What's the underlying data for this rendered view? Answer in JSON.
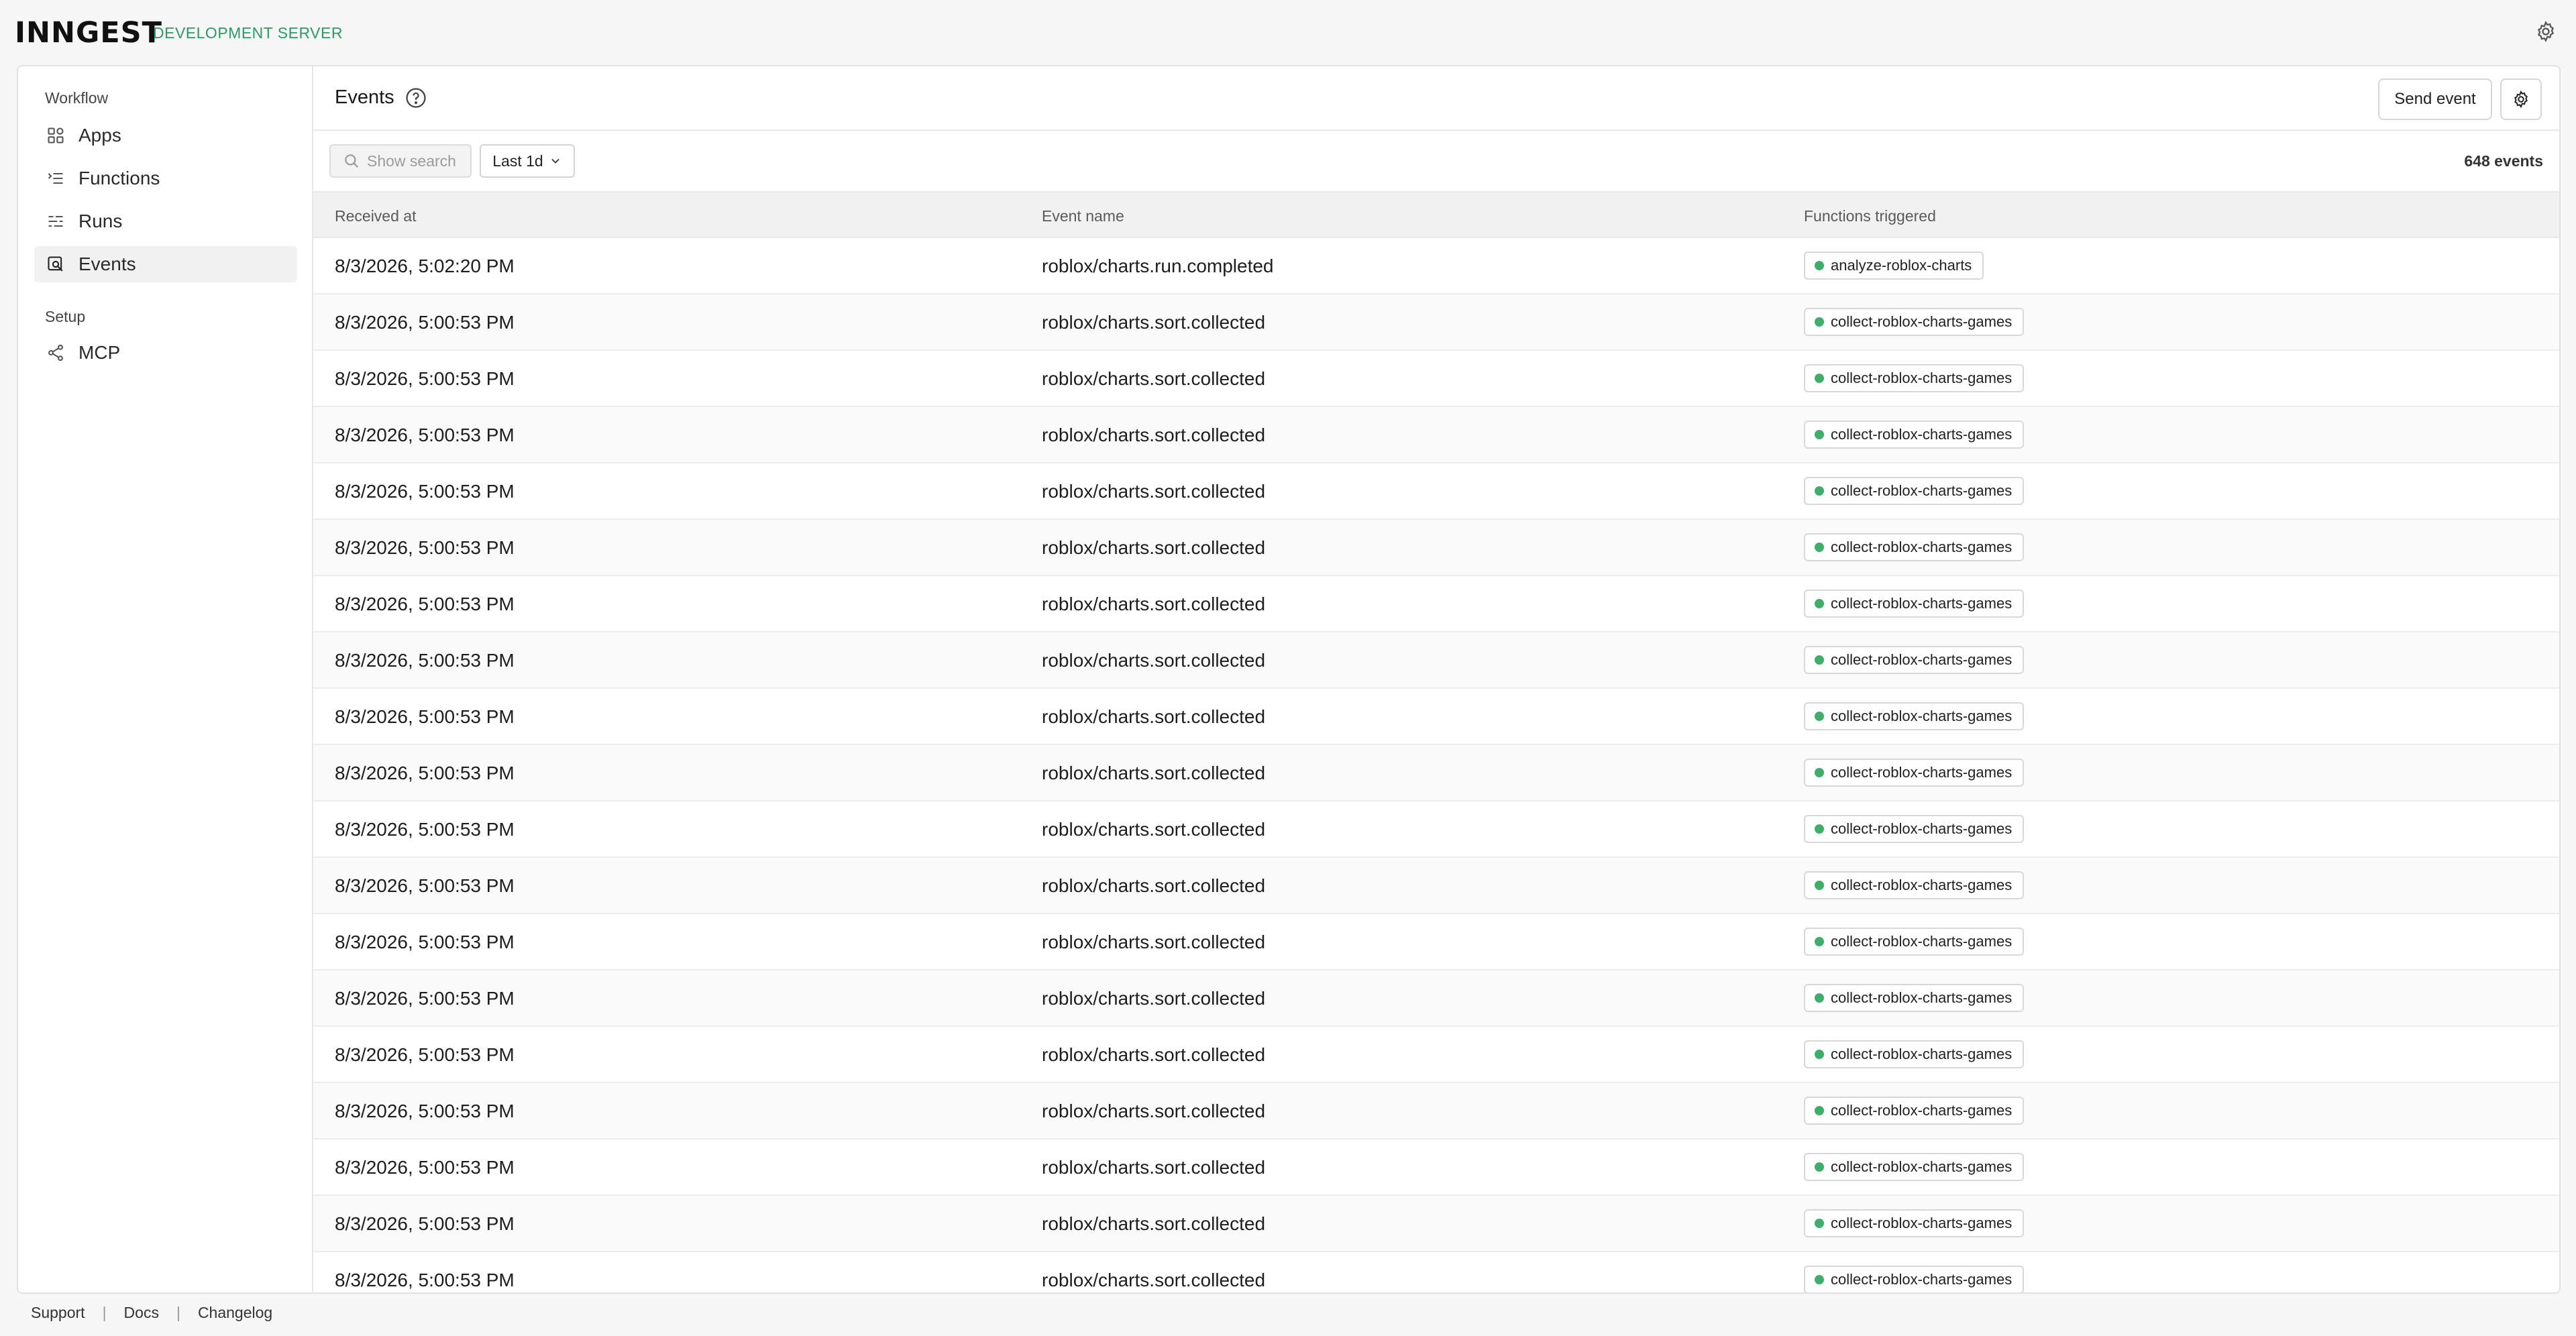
{
  "app": {
    "logo": "INNGEST",
    "subtitle": "DEVELOPMENT SERVER"
  },
  "sidebar": {
    "groups": [
      {
        "label": "Workflow"
      },
      {
        "label": "Setup"
      }
    ],
    "items": [
      {
        "label": "Apps",
        "icon": "apps-icon"
      },
      {
        "label": "Functions",
        "icon": "functions-icon"
      },
      {
        "label": "Runs",
        "icon": "runs-icon"
      },
      {
        "label": "Events",
        "icon": "events-icon",
        "active": true
      },
      {
        "label": "MCP",
        "icon": "mcp-icon"
      }
    ]
  },
  "header": {
    "title": "Events",
    "send_label": "Send event"
  },
  "toolbar": {
    "search_placeholder": "Show search",
    "range_label": "Last 1d",
    "count": "648 events"
  },
  "table": {
    "columns": [
      "Received at",
      "Event name",
      "Functions triggered"
    ],
    "rows": [
      {
        "received": "8/3/2026, 5:02:20 PM",
        "event": "roblox/charts.run.completed",
        "fn": "analyze-roblox-charts"
      },
      {
        "received": "8/3/2026, 5:00:53 PM",
        "event": "roblox/charts.sort.collected",
        "fn": "collect-roblox-charts-games"
      },
      {
        "received": "8/3/2026, 5:00:53 PM",
        "event": "roblox/charts.sort.collected",
        "fn": "collect-roblox-charts-games"
      },
      {
        "received": "8/3/2026, 5:00:53 PM",
        "event": "roblox/charts.sort.collected",
        "fn": "collect-roblox-charts-games"
      },
      {
        "received": "8/3/2026, 5:00:53 PM",
        "event": "roblox/charts.sort.collected",
        "fn": "collect-roblox-charts-games"
      },
      {
        "received": "8/3/2026, 5:00:53 PM",
        "event": "roblox/charts.sort.collected",
        "fn": "collect-roblox-charts-games"
      },
      {
        "received": "8/3/2026, 5:00:53 PM",
        "event": "roblox/charts.sort.collected",
        "fn": "collect-roblox-charts-games"
      },
      {
        "received": "8/3/2026, 5:00:53 PM",
        "event": "roblox/charts.sort.collected",
        "fn": "collect-roblox-charts-games"
      },
      {
        "received": "8/3/2026, 5:00:53 PM",
        "event": "roblox/charts.sort.collected",
        "fn": "collect-roblox-charts-games"
      },
      {
        "received": "8/3/2026, 5:00:53 PM",
        "event": "roblox/charts.sort.collected",
        "fn": "collect-roblox-charts-games"
      },
      {
        "received": "8/3/2026, 5:00:53 PM",
        "event": "roblox/charts.sort.collected",
        "fn": "collect-roblox-charts-games"
      },
      {
        "received": "8/3/2026, 5:00:53 PM",
        "event": "roblox/charts.sort.collected",
        "fn": "collect-roblox-charts-games"
      },
      {
        "received": "8/3/2026, 5:00:53 PM",
        "event": "roblox/charts.sort.collected",
        "fn": "collect-roblox-charts-games"
      },
      {
        "received": "8/3/2026, 5:00:53 PM",
        "event": "roblox/charts.sort.collected",
        "fn": "collect-roblox-charts-games"
      },
      {
        "received": "8/3/2026, 5:00:53 PM",
        "event": "roblox/charts.sort.collected",
        "fn": "collect-roblox-charts-games"
      },
      {
        "received": "8/3/2026, 5:00:53 PM",
        "event": "roblox/charts.sort.collected",
        "fn": "collect-roblox-charts-games"
      },
      {
        "received": "8/3/2026, 5:00:53 PM",
        "event": "roblox/charts.sort.collected",
        "fn": "collect-roblox-charts-games"
      },
      {
        "received": "8/3/2026, 5:00:53 PM",
        "event": "roblox/charts.sort.collected",
        "fn": "collect-roblox-charts-games"
      },
      {
        "received": "8/3/2026, 5:00:53 PM",
        "event": "roblox/charts.sort.collected",
        "fn": "collect-roblox-charts-games"
      }
    ]
  },
  "footer": {
    "links": [
      "Support",
      "Docs",
      "Changelog"
    ]
  },
  "colors": {
    "accent": "#2c9b63",
    "status_dot": "#3fae6b"
  }
}
